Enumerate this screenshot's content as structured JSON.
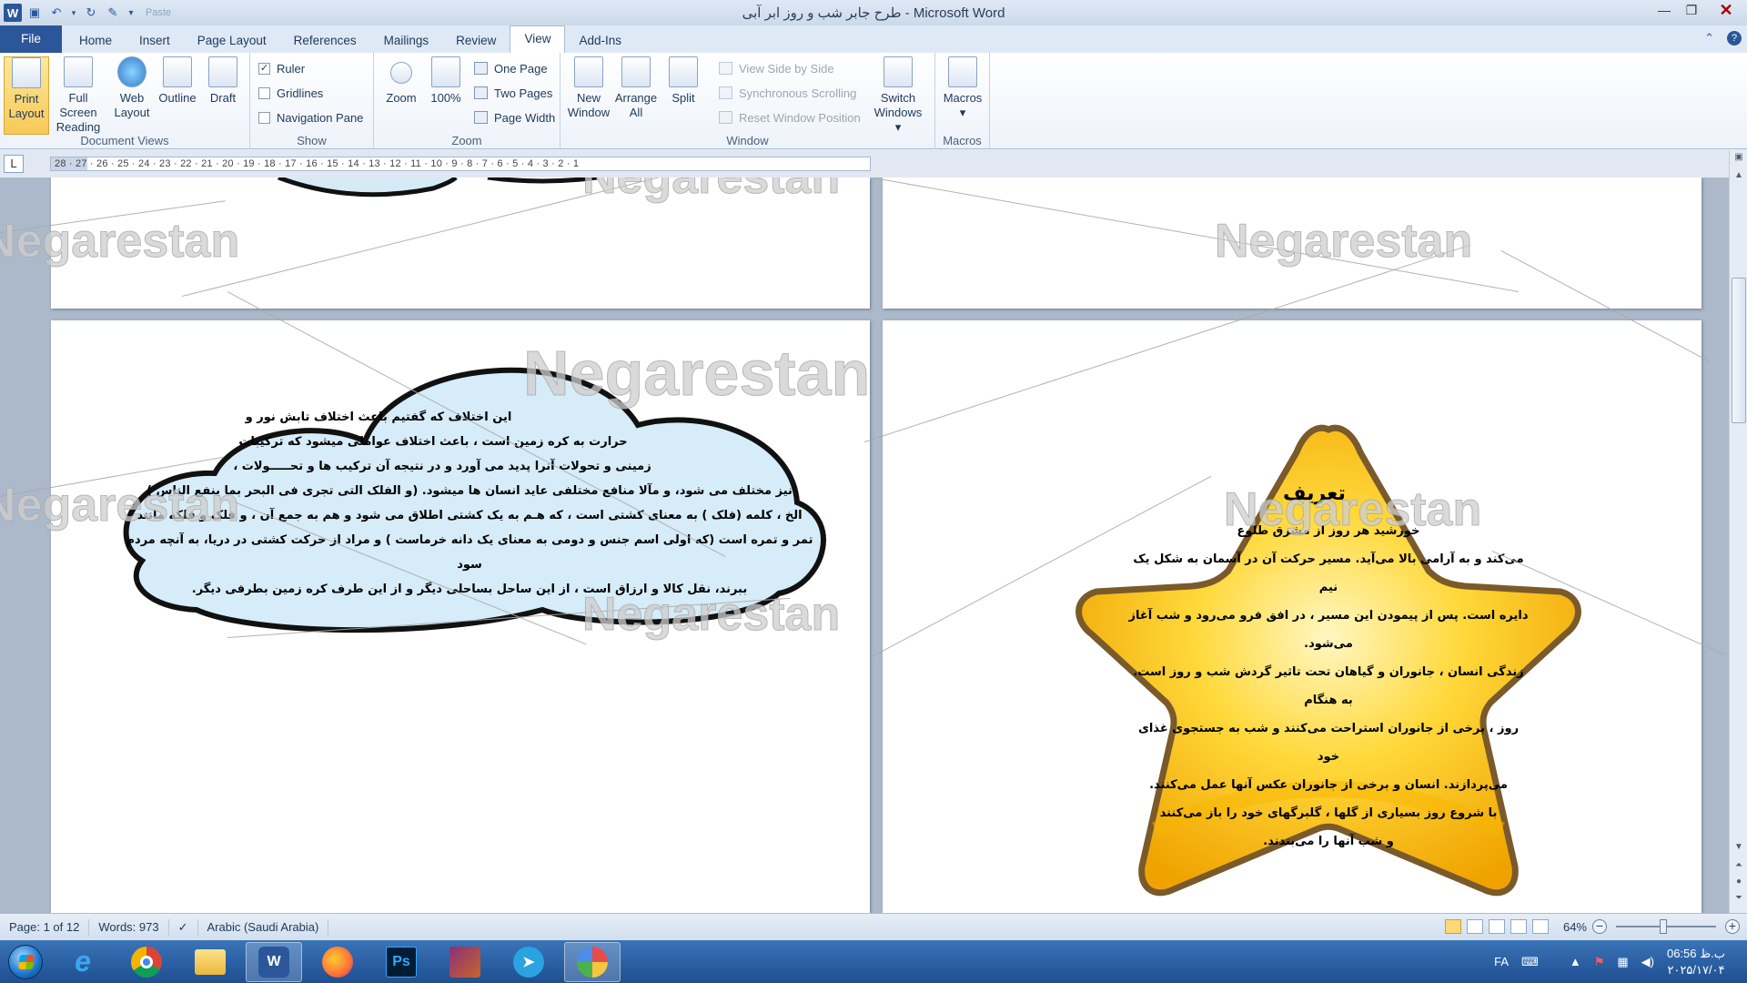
{
  "window": {
    "title": "طرح جابر شب و روز ابر آبی  -  Microsoft Word",
    "qat_customize": "Paste"
  },
  "tabs": [
    "File",
    "Home",
    "Insert",
    "Page Layout",
    "References",
    "Mailings",
    "Review",
    "View",
    "Add-Ins"
  ],
  "active_tab": "View",
  "ribbon": {
    "document_views": {
      "label": "Document Views",
      "print_layout": "Print Layout",
      "full_screen": "Full Screen Reading",
      "web_layout": "Web Layout",
      "outline": "Outline",
      "draft": "Draft"
    },
    "show": {
      "label": "Show",
      "ruler": "Ruler",
      "gridlines": "Gridlines",
      "navigation_pane": "Navigation Pane",
      "ruler_checked": true,
      "gridlines_checked": false,
      "navigation_checked": false
    },
    "zoom": {
      "label": "Zoom",
      "zoom": "Zoom",
      "hundred": "100%",
      "one_page": "One Page",
      "two_pages": "Two Pages",
      "page_width": "Page Width"
    },
    "window": {
      "label": "Window",
      "new_window": "New Window",
      "arrange_all": "Arrange All",
      "split": "Split",
      "view_side_by_side": "View Side by Side",
      "sync_scrolling": "Synchronous Scrolling",
      "reset_position": "Reset Window Position",
      "switch_windows": "Switch Windows"
    },
    "macros": {
      "label": "Macros",
      "macros": "Macros"
    }
  },
  "ruler": {
    "marks": "28 · 27 · 26 · 25 · 24 · 23 · 22 · 21 · 20 · 19 · 18 · 17 · 16 · 15 · 14 · 13 · 12 · 11 · 10 · 9 · 8 · 7 · 6 · 5 · 4 · 3 · 2 · 1"
  },
  "watermark": "Negarestan",
  "cloud_lines": [
    "این اختلاف که گفتیم باعث اختلاف تابش نور و",
    "حرارت به کره زمین است ، باعث اختلاف عواملی میشود که ترکیبات",
    "زمینی و تحولات آنرا پدید می آورد و در نتیجه آن ترکیب ها و تحـــــولات ،",
    "نیز مختلف می شود، و مآلا منافع مختلفی عاید انسان ها میشود. (و الفلک التی تجری فی البحر بما ینفع الناس )",
    "الخ ، کلمه (فلک ) به معنای کشتی است ، که هـم به یک کشتی اطلاق می شود و هم به جمع آن ، و فلک و فلکه مانند",
    "تمر و تمره است (که اولی اسم جنس و دومی به معنای یک دانه خرماست ) و مراد از حرکت کشتی در دریا، به آنچه مردم سود",
    "ببرند، نقل کالا و ارزاق است ، از این ساحل بساحلی دیگر و از این طرف کره زمین بطرفی دیگر."
  ],
  "star": {
    "title": "تعریف",
    "lines": [
      "خورشید هر روز از مشرق طلوع",
      "می‌کند و به آرامی بالا می‌آید. مسیر حرکت آن در آسمان به شکل یک نیم",
      "دایره است. پس از پیمودن این مسیر ، در افق فرو می‌رود و شب آغاز می‌شود.",
      "زندگی انسان ، جانوران و گیاهان تحت تاثیر گردش شب و روز است. به هنگام",
      "روز ، برخی از جانوران استراحت می‌کنند و شب به جستجوی غذای خود",
      "می‌پردازند. انسان و برخی از جانوران عکس آنها عمل می‌کنند.",
      "با شروع روز بسیاری از گلها ، گلبرگهای خود را باز می‌کنند",
      "و شب آنها را می‌بندند."
    ]
  },
  "status": {
    "page": "Page: 1 of 12",
    "words": "Words: 973",
    "language": "Arabic (Saudi Arabia)",
    "zoom": "64%",
    "zoom_level": 0.64
  },
  "taskbar": {
    "lang": "FA",
    "time": "06:56 ب.ظ",
    "date": "۲۰۲۵/۱۷/۰۴",
    "apps": [
      "internet-explorer",
      "chrome",
      "file-explorer",
      "word",
      "firefox",
      "photoshop",
      "winrar",
      "telegram",
      "paint"
    ]
  }
}
